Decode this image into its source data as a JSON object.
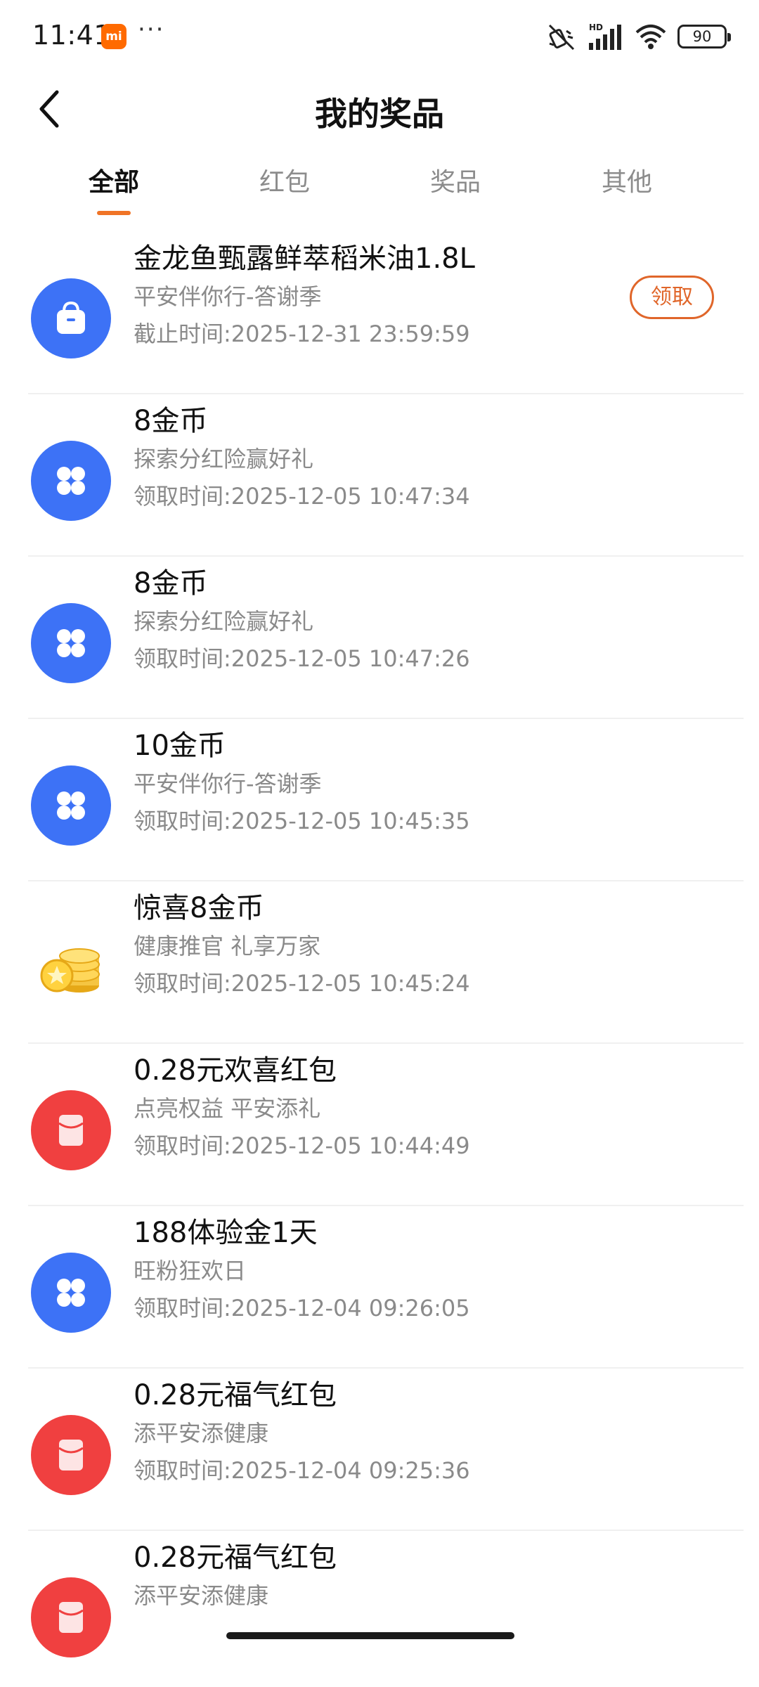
{
  "status_bar": {
    "time": "11:41",
    "mi_badge": "mi",
    "dots": "···",
    "battery": "90"
  },
  "header": {
    "title": "我的奖品"
  },
  "tabs": [
    {
      "label": "全部",
      "active": true
    },
    {
      "label": "红包",
      "active": false
    },
    {
      "label": "奖品",
      "active": false
    },
    {
      "label": "其他",
      "active": false
    }
  ],
  "items": [
    {
      "icon": "shopping-bag-icon",
      "title": "金龙鱼甄露鲜萃稻米油1.8L",
      "subtitle": "平安伴你行-答谢季",
      "time": "截止时间:2025-12-31 23:59:59",
      "action": "领取"
    },
    {
      "icon": "coins-grid-icon",
      "title": "8金币",
      "subtitle": "探索分红险赢好礼",
      "time": "领取时间:2025-12-05 10:47:34"
    },
    {
      "icon": "coins-grid-icon",
      "title": "8金币",
      "subtitle": "探索分红险赢好礼",
      "time": "领取时间:2025-12-05 10:47:26"
    },
    {
      "icon": "coins-grid-icon",
      "title": "10金币",
      "subtitle": "平安伴你行-答谢季",
      "time": "领取时间:2025-12-05 10:45:35"
    },
    {
      "icon": "gold-coins-icon",
      "title": "惊喜8金币",
      "subtitle": "健康推官 礼享万家",
      "time": "领取时间:2025-12-05 10:45:24"
    },
    {
      "icon": "red-envelope-icon",
      "title": "0.28元欢喜红包",
      "subtitle": "点亮权益 平安添礼",
      "time": "领取时间:2025-12-05 10:44:49"
    },
    {
      "icon": "coins-grid-icon",
      "title": "188体验金1天",
      "subtitle": "旺粉狂欢日",
      "time": "领取时间:2025-12-04 09:26:05"
    },
    {
      "icon": "red-envelope-icon",
      "title": "0.28元福气红包",
      "subtitle": "添平安添健康",
      "time": "领取时间:2025-12-04 09:25:36"
    },
    {
      "icon": "red-envelope-icon",
      "title": "0.28元福气红包",
      "subtitle": "添平安添健康",
      "time": ""
    }
  ],
  "colors": {
    "accent": "#f07426",
    "claim": "#e0662a",
    "icon_blue": "#3d72f6",
    "icon_red": "#f04040"
  }
}
